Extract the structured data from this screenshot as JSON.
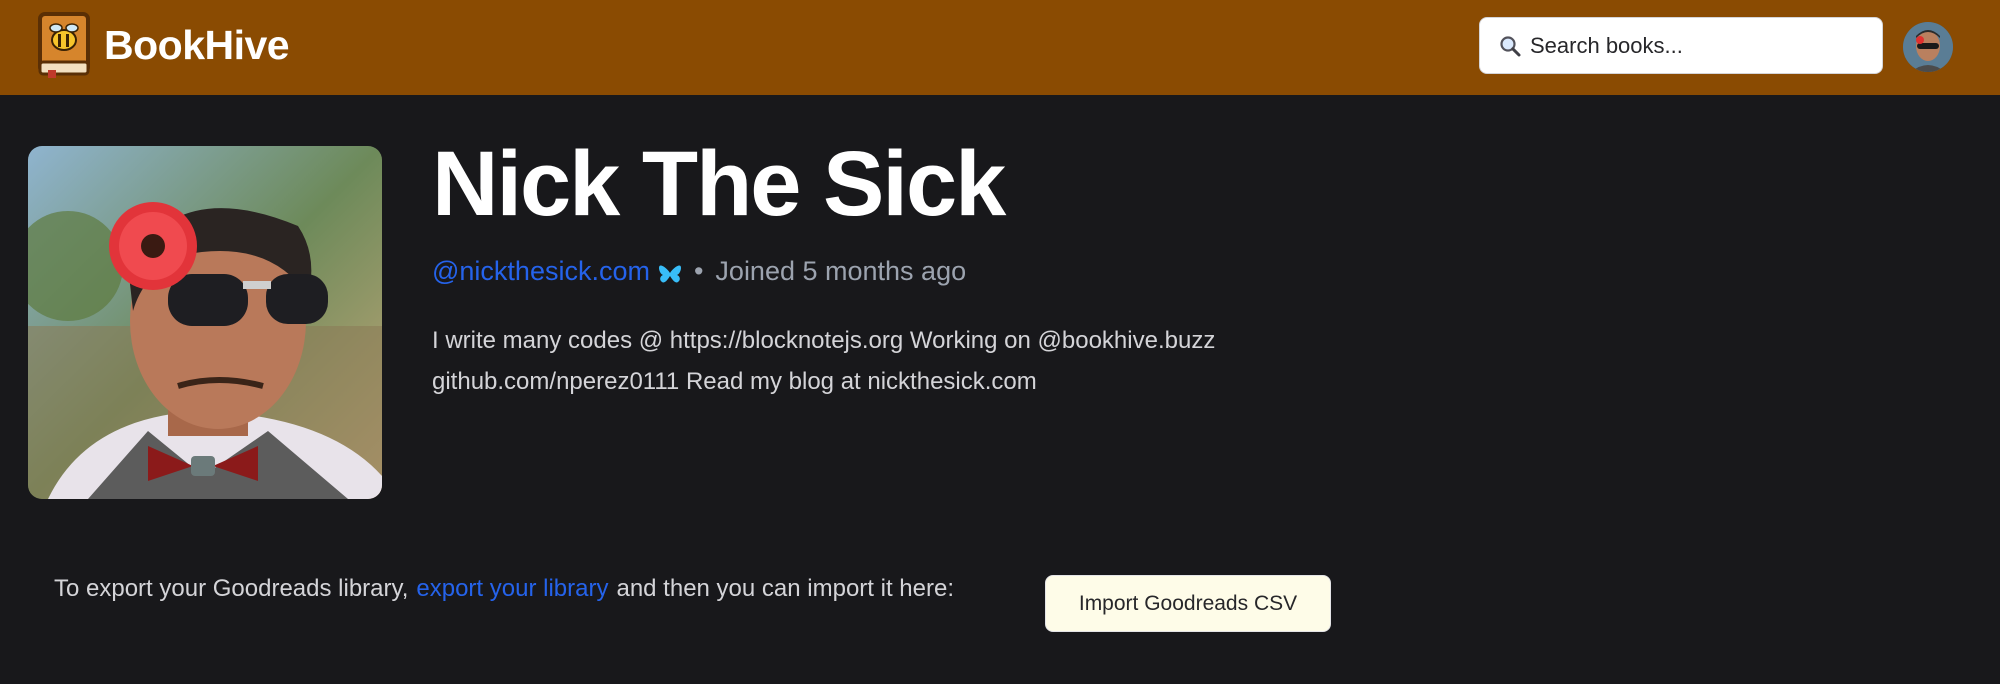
{
  "header": {
    "brand": "BookHive",
    "search_placeholder": "Search books...",
    "colors": {
      "bar": "#8a4b02"
    }
  },
  "profile": {
    "name": "Nick The Sick",
    "handle": "@nickthesick.com",
    "joined": "Joined 5 months ago",
    "bio": "I write many codes @ https://blocknotejs.org Working on @bookhive.buzz github.com/nperez0111 Read my blog at nickthesick.com"
  },
  "import": {
    "text_before": "To export your Goodreads library,",
    "link": "export your library",
    "text_after": "and then you can import it here:",
    "button": "Import Goodreads CSV"
  },
  "icons": {
    "logo": "bee-book-icon",
    "search": "magnifier-icon",
    "bluesky": "butterfly-icon"
  },
  "colors": {
    "background": "#18181b",
    "link": "#2563eb",
    "button_bg": "#fefce8"
  }
}
